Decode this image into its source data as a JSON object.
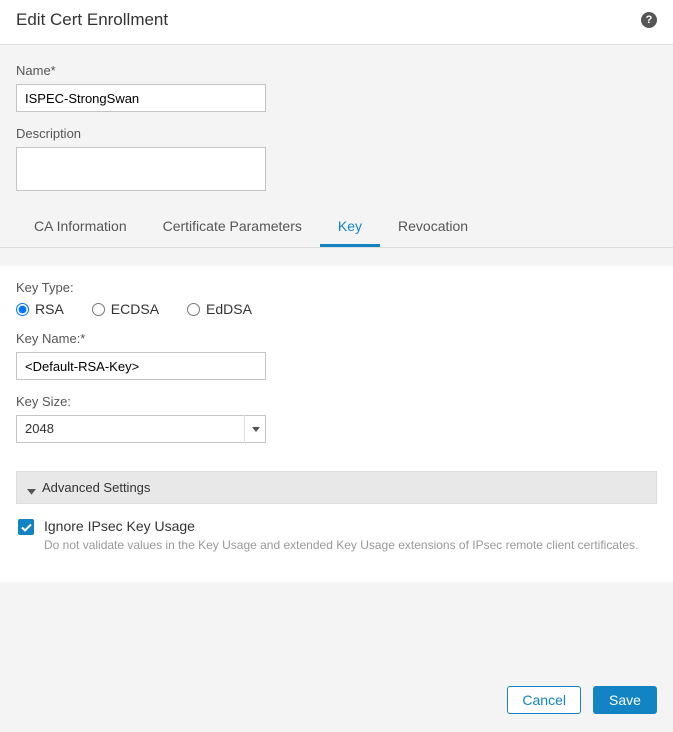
{
  "header": {
    "title": "Edit Cert Enrollment"
  },
  "form": {
    "name_label": "Name*",
    "name_value": "ISPEC-StrongSwan",
    "desc_label": "Description",
    "desc_value": ""
  },
  "tabs": {
    "ca": "CA Information",
    "params": "Certificate Parameters",
    "key": "Key",
    "revocation": "Revocation"
  },
  "key": {
    "type_label": "Key Type:",
    "radio_rsa": "RSA",
    "radio_ecdsa": "ECDSA",
    "radio_eddsa": "EdDSA",
    "name_label": "Key Name:*",
    "name_value": "<Default-RSA-Key>",
    "size_label": "Key Size:",
    "size_value": "2048"
  },
  "advanced": {
    "header": "Advanced Settings",
    "ignore_label": "Ignore IPsec Key Usage",
    "ignore_desc": "Do not validate values in the Key Usage and extended Key Usage extensions of IPsec remote client certificates."
  },
  "footer": {
    "cancel": "Cancel",
    "save": "Save"
  }
}
